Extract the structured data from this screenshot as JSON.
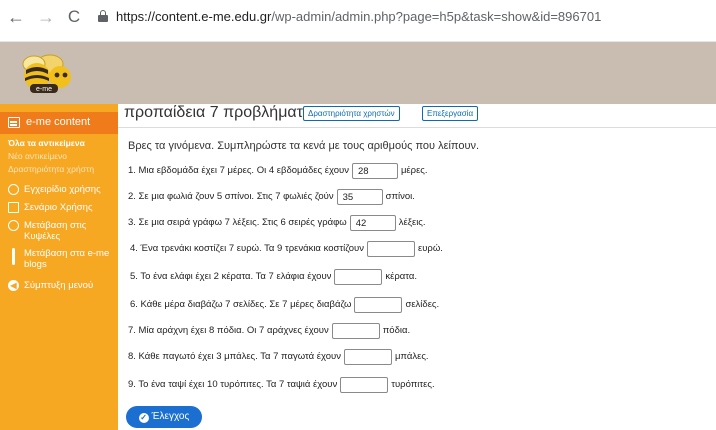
{
  "browser": {
    "url_host": "https://content.e-me.edu.gr",
    "url_path": "/wp-admin/admin.php?page=h5p&task=show&id=896701"
  },
  "logo_text": "e-me",
  "sidebar": {
    "active": "e-me content",
    "sub_items": [
      "Όλα τα αντικείμενα",
      "Νέο αντικείμενο",
      "Δραστηριότητα χρήστη"
    ],
    "items": [
      {
        "icon": "help-circle-icon",
        "label": "Εγχειρίδιο χρήσης"
      },
      {
        "icon": "document-icon",
        "label": "Σενάριο Χρήσης"
      },
      {
        "icon": "circle-icon",
        "label": "Μετάβαση στις Κυψέλες"
      },
      {
        "icon": "pin-icon",
        "label": "Μετάβαση στα e-me blogs"
      },
      {
        "icon": "collapse-icon",
        "label": "Σύμπτυξη μενού"
      }
    ]
  },
  "main": {
    "title": "προπαίδεια 7 προβλήματα",
    "buttons": [
      "Δραστηριότητα χρηστών",
      "Επεξεργασία"
    ],
    "instructions": "Βρες τα γινόμενα. Συμπληρώστε τα κενά με τους αριθμούς που λείπουν.",
    "questions": [
      {
        "before": "1. Μια εβδομάδα έχει 7 μέρες. Οι 4 εβδομάδες έχουν",
        "value": "28",
        "after": "μέρες."
      },
      {
        "before": "2. Σε μια φωλιά ζουν 5 σπίνοι. Στις 7 φωλιές ζούν",
        "value": "35",
        "after": "σπίνοι."
      },
      {
        "before": "3. Σε μια σειρά γράφω 7 λέξεις. Στις 6 σειρές γράφω",
        "value": "42",
        "after": "λέξεις."
      },
      {
        "before": "4. Ένα τρενάκι κοστίζει 7 ευρώ. Τα 9 τρενάκια κοστίζουν",
        "value": "",
        "after": "ευρώ."
      },
      {
        "before": "5. Το ένα ελάφι έχει 2 κέρατα. Τα 7 ελάφια έχουν",
        "value": "",
        "after": "κέρατα."
      },
      {
        "before": "6. Κάθε μέρα διαβάζω 7 σελίδες. Σε 7 μέρες διαβάζω",
        "value": "",
        "after": "σελίδες."
      },
      {
        "before": "7.  Μία αράχνη έχει 8 πόδια. Οι 7 αράχνες έχουν",
        "value": "",
        "after": "πόδια."
      },
      {
        "before": "8. Κάθε παγωτό έχει 3 μπάλες. Τα 7 παγωτά έχουν",
        "value": "",
        "after": "μπάλες."
      },
      {
        "before": "9. Το ένα ταψί έχει 10 τυρόπιτες. Τα 7 ταψιά έχουν",
        "value": "",
        "after": "τυρόπιτες."
      }
    ],
    "check_label": "Έλεγχος"
  },
  "colors": {
    "sidebar": "#f7a823",
    "sidebar_active": "#ef7b1a",
    "header": "#c9bcb1",
    "primary": "#1a6fd0"
  }
}
